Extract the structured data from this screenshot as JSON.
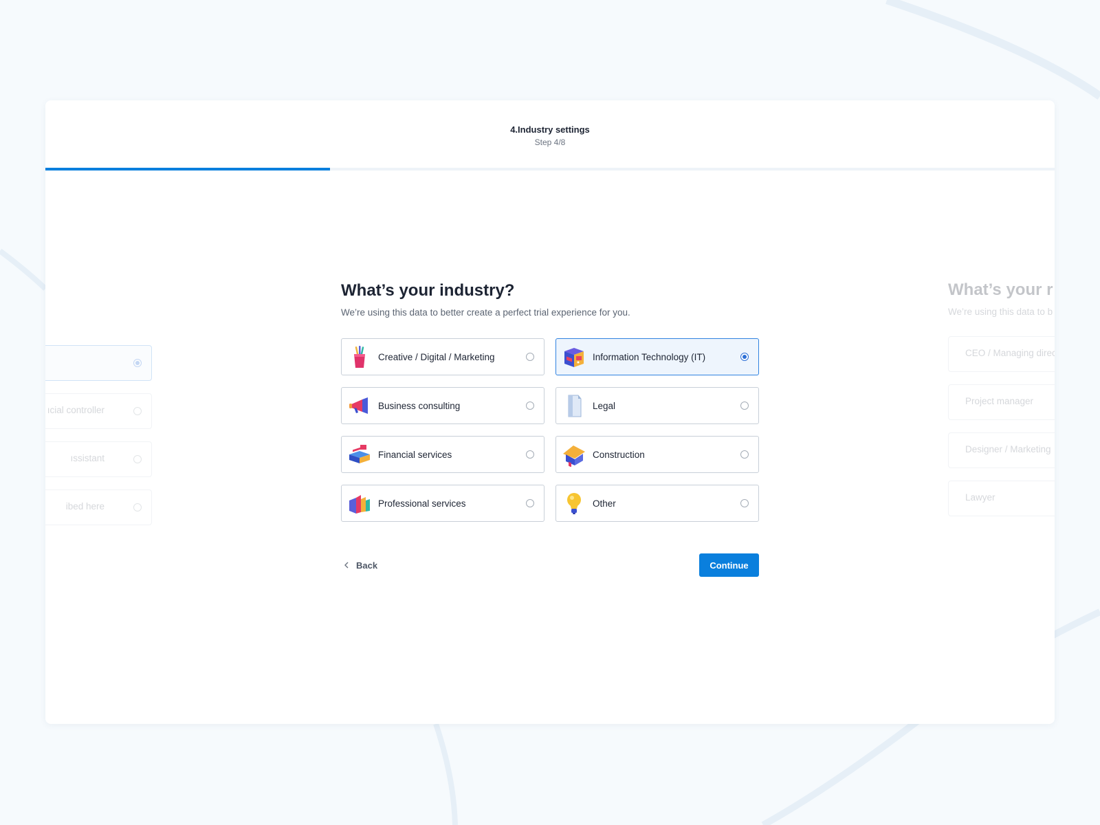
{
  "header": {
    "step_title": "4.Industry settings",
    "step_count": "Step 4/8",
    "progress_fraction": 0.282
  },
  "form": {
    "title": "What’s your industry?",
    "subtitle": "We’re using this data to better create a perfect trial experience for you.",
    "options": [
      {
        "label": "Creative / Digital / Marketing",
        "icon": "pencil-cup-icon",
        "selected": false
      },
      {
        "label": "Information Technology (IT)",
        "icon": "computer-box-icon",
        "selected": true
      },
      {
        "label": "Business consulting",
        "icon": "megaphone-icon",
        "selected": false
      },
      {
        "label": "Legal",
        "icon": "document-icon",
        "selected": false
      },
      {
        "label": "Financial services",
        "icon": "cash-register-icon",
        "selected": false
      },
      {
        "label": "Construction",
        "icon": "house-icon",
        "selected": false
      },
      {
        "label": "Professional services",
        "icon": "books-icon",
        "selected": false
      },
      {
        "label": "Other",
        "icon": "lightbulb-icon",
        "selected": false
      }
    ],
    "back_label": "Back",
    "continue_label": "Continue"
  },
  "previous_step": {
    "options": [
      {
        "label": "",
        "selected": true
      },
      {
        "label": "ıcial controller",
        "selected": false
      },
      {
        "label": "ıssistant",
        "selected": false
      },
      {
        "label": "ibed here",
        "selected": false
      }
    ]
  },
  "next_step": {
    "title": "What’s your r",
    "subtitle": "We’re using this data to b",
    "options": [
      {
        "label": "CEO / Managing direc",
        "selected": false
      },
      {
        "label": "Project manager",
        "selected": false
      },
      {
        "label": "Designer / Marketing",
        "selected": false
      },
      {
        "label": "Lawyer",
        "selected": false
      }
    ]
  },
  "colors": {
    "accent": "#0a7fdd",
    "selected_border": "#2f82e0",
    "selected_bg": "#eef5fd",
    "page_bg": "#f6fafd"
  }
}
